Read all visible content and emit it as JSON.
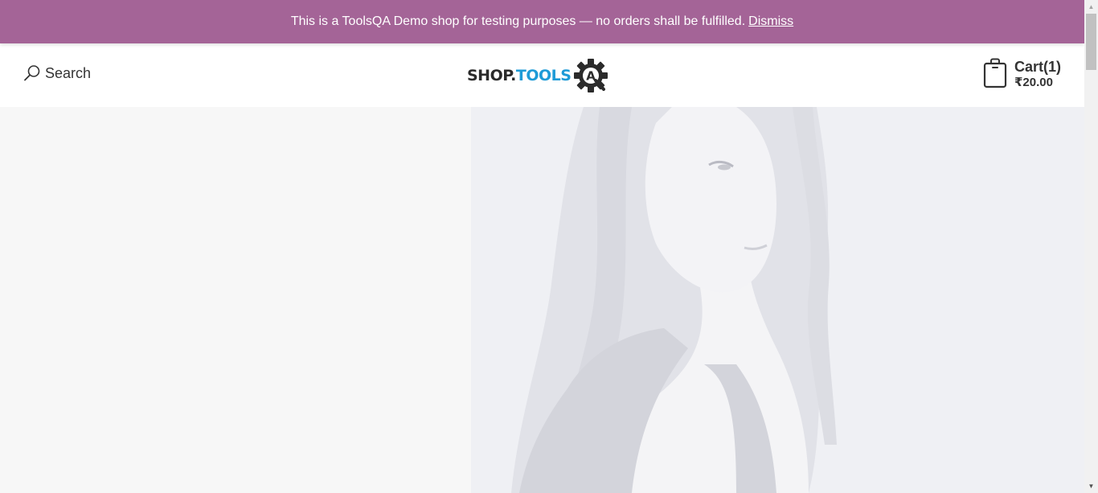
{
  "notice": {
    "text": "This is a ToolsQA Demo shop for testing purposes — no orders shall be fulfilled.",
    "dismiss_label": "Dismiss",
    "background": "#a46497"
  },
  "header": {
    "search_label": "Search",
    "logo": {
      "shop_text": "SHOP.",
      "tools_text": "TOOLS",
      "badge_letter": "A",
      "shop_color": "#2b2b2b",
      "tools_color": "#1e9bd7"
    },
    "cart": {
      "title": "Cart(1)",
      "total": "₹20.00"
    }
  },
  "hero": {
    "background": "#eff0f4"
  },
  "icons": {
    "search": "search-icon",
    "cart": "shopping-bag-icon",
    "logo_gear": "gear-icon"
  }
}
